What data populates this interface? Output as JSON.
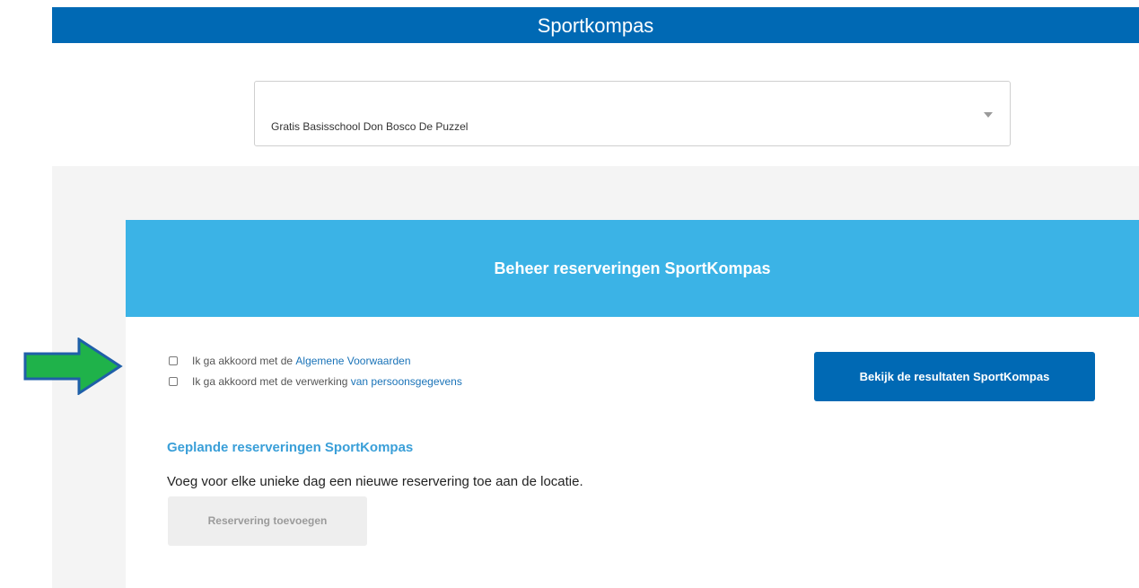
{
  "header": {
    "title": "Sportkompas"
  },
  "school_select": {
    "value": "Gratis Basisschool Don Bosco De Puzzel"
  },
  "panel": {
    "title": "Beheer reserveringen SportKompas",
    "consent": [
      {
        "text": "Ik ga akkoord met de ",
        "link": "Algemene Voorwaarden"
      },
      {
        "text": "Ik ga akkoord met de verwerking ",
        "link": "van persoonsgegevens"
      }
    ],
    "results_button": "Bekijk de resultaten SportKompas",
    "planned_title": "Geplande reserveringen SportKompas",
    "planned_text": "Voeg voor elke unieke dag een nieuwe reservering toe aan de locatie.",
    "add_button": "Reservering toevoegen"
  },
  "colors": {
    "header_blue": "#0069b4",
    "panel_header": "#3bb3e6",
    "annotation_arrow": "#1fb24a"
  }
}
